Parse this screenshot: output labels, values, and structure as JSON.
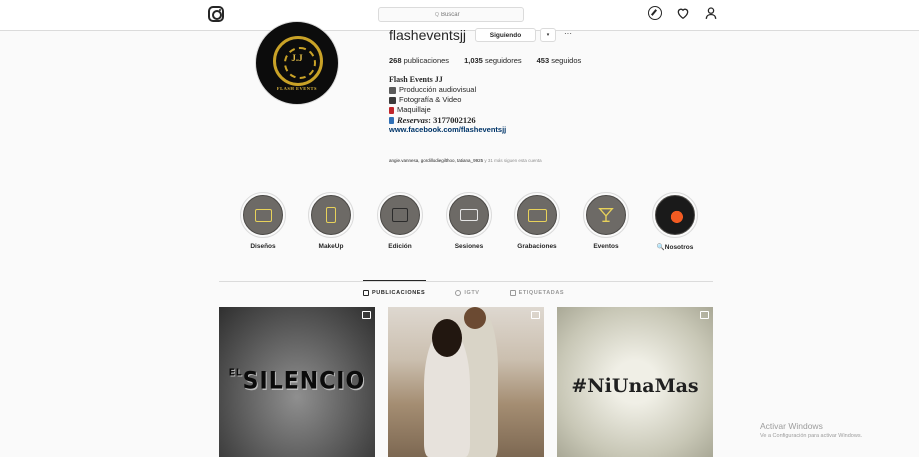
{
  "search": {
    "placeholder": "Buscar",
    "glyph": "Q"
  },
  "profile": {
    "username": "flasheventsjj",
    "follow_label": "Siguiendo",
    "dropdown_glyph": "▾",
    "more_glyph": "···",
    "stats": {
      "posts_count": "268",
      "posts_label": "publicaciones",
      "followers_count": "1,035",
      "followers_label": "seguidores",
      "following_count": "453",
      "following_label": "seguidos"
    },
    "avatar": {
      "monogram": "J.J",
      "brand": "FLASH EVENTS"
    },
    "bio": {
      "name": "Flash Events JJ",
      "line1": "Producción audiovisual",
      "line2": "Fotografía & Video",
      "line3": "Maquillaje",
      "reservas_label": "Reservas",
      "reservas_number": ": 3177002126",
      "link": "www.facebook.com/flasheventsjj"
    },
    "followed_by": {
      "names": "angie.vannesa, gordillodiegilthoo, tatiana_9925",
      "rest": " y 31 más siguen esta cuenta"
    }
  },
  "highlights": [
    {
      "label": "Diseños",
      "icon": "laptop-heart-icon"
    },
    {
      "label": "MakeUp",
      "icon": "makeup-brush-icon"
    },
    {
      "label": "Edición",
      "icon": "computer-icon"
    },
    {
      "label": "Sesiones",
      "icon": "camera-icon"
    },
    {
      "label": "Grabaciones",
      "icon": "video-player-icon"
    },
    {
      "label": "Eventos",
      "icon": "cocktail-glass-icon"
    },
    {
      "label": "🔍Nosotros",
      "icon": "photo-cover-icon"
    }
  ],
  "tabs": [
    {
      "label": "PUBLICACIONES",
      "active": true
    },
    {
      "label": "IGTV",
      "active": false
    },
    {
      "label": "ETIQUETADAS",
      "active": false
    }
  ],
  "posts": [
    {
      "title_prefix": "EL",
      "title": "SILENCIO"
    },
    {
      "title": ""
    },
    {
      "title": "#NiUnaMas"
    }
  ],
  "watermark": {
    "line1": "Activar Windows",
    "line2": "Ve a Configuración para activar Windows."
  },
  "colors": {
    "accent": "#003569",
    "border": "#dbdbdb",
    "highlight_gold": "#e8d25a"
  }
}
